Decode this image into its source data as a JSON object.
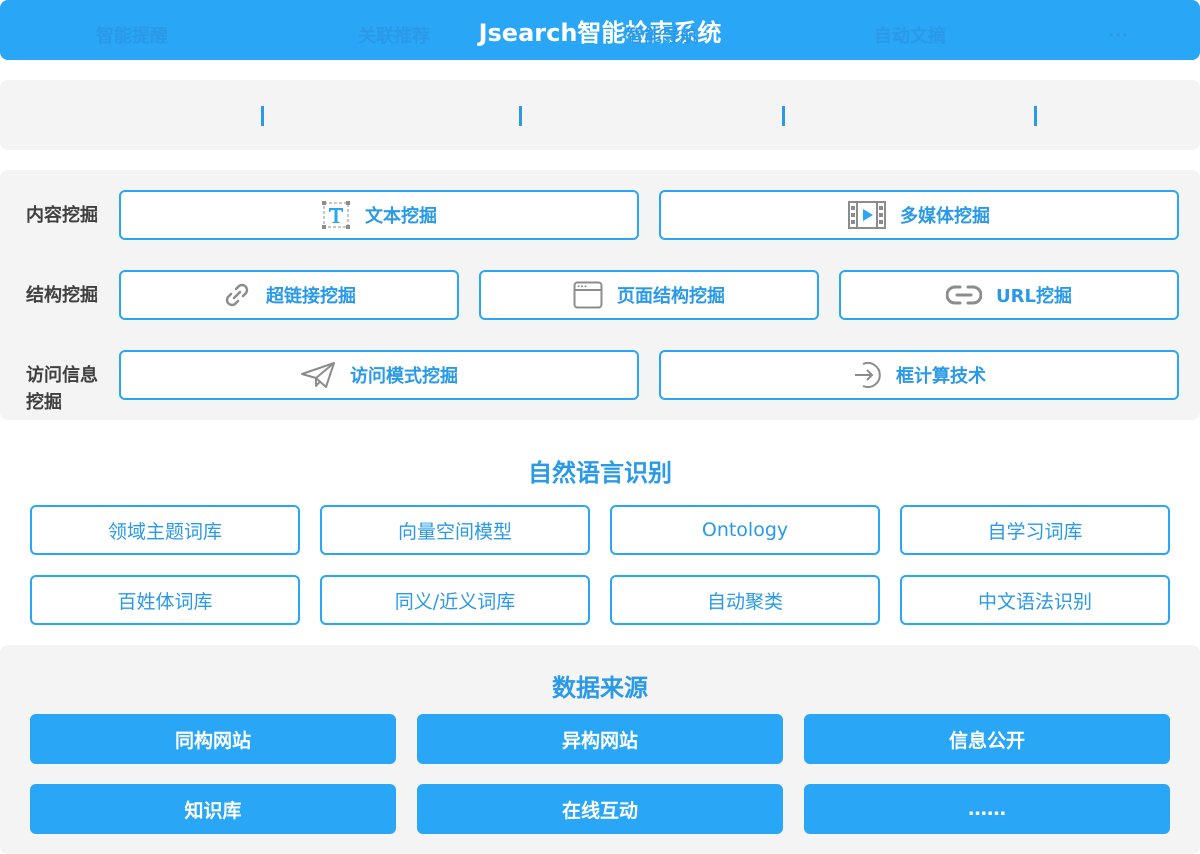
{
  "title": "Jsearch智能检索系统",
  "features": {
    "items": [
      "智能提醒",
      "关联推荐",
      "智能导航",
      "自动文摘",
      "···"
    ],
    "separator": "|"
  },
  "mining": {
    "content": {
      "label": "内容挖掘",
      "items": [
        {
          "label": "文本挖掘",
          "icon": "text-T-icon"
        },
        {
          "label": "多媒体挖掘",
          "icon": "film-strip-icon"
        }
      ]
    },
    "structure": {
      "label": "结构挖掘",
      "items": [
        {
          "label": "超链接挖掘",
          "icon": "link-chain-icon"
        },
        {
          "label": "页面结构挖掘",
          "icon": "browser-window-icon"
        },
        {
          "label": "URL挖掘",
          "icon": "link-icon"
        }
      ]
    },
    "access": {
      "label_line1": "访问信息",
      "label_line2": "挖掘",
      "items": [
        {
          "label": "访问模式挖掘",
          "icon": "paper-plane-icon"
        },
        {
          "label": "框计算技术",
          "icon": "arrow-in-circle-icon"
        }
      ]
    }
  },
  "nlp": {
    "title": "自然语言识别",
    "items": [
      "领域主题词库",
      "向量空间模型",
      "Ontology",
      "自学习词库",
      "百姓体词库",
      "同义/近义词库",
      "自动聚类",
      "中文语法识别"
    ]
  },
  "sources": {
    "title": "数据来源",
    "items": [
      "同构网站",
      "异构网站",
      "信息公开",
      "知识库",
      "在线互动",
      "……"
    ]
  },
  "colors": {
    "accent": "#29a6f6",
    "accent_text": "#2a9ae8",
    "panel_bg": "#f4f4f4",
    "label_text": "#404040",
    "icon_gray": "#8c8c8c"
  }
}
